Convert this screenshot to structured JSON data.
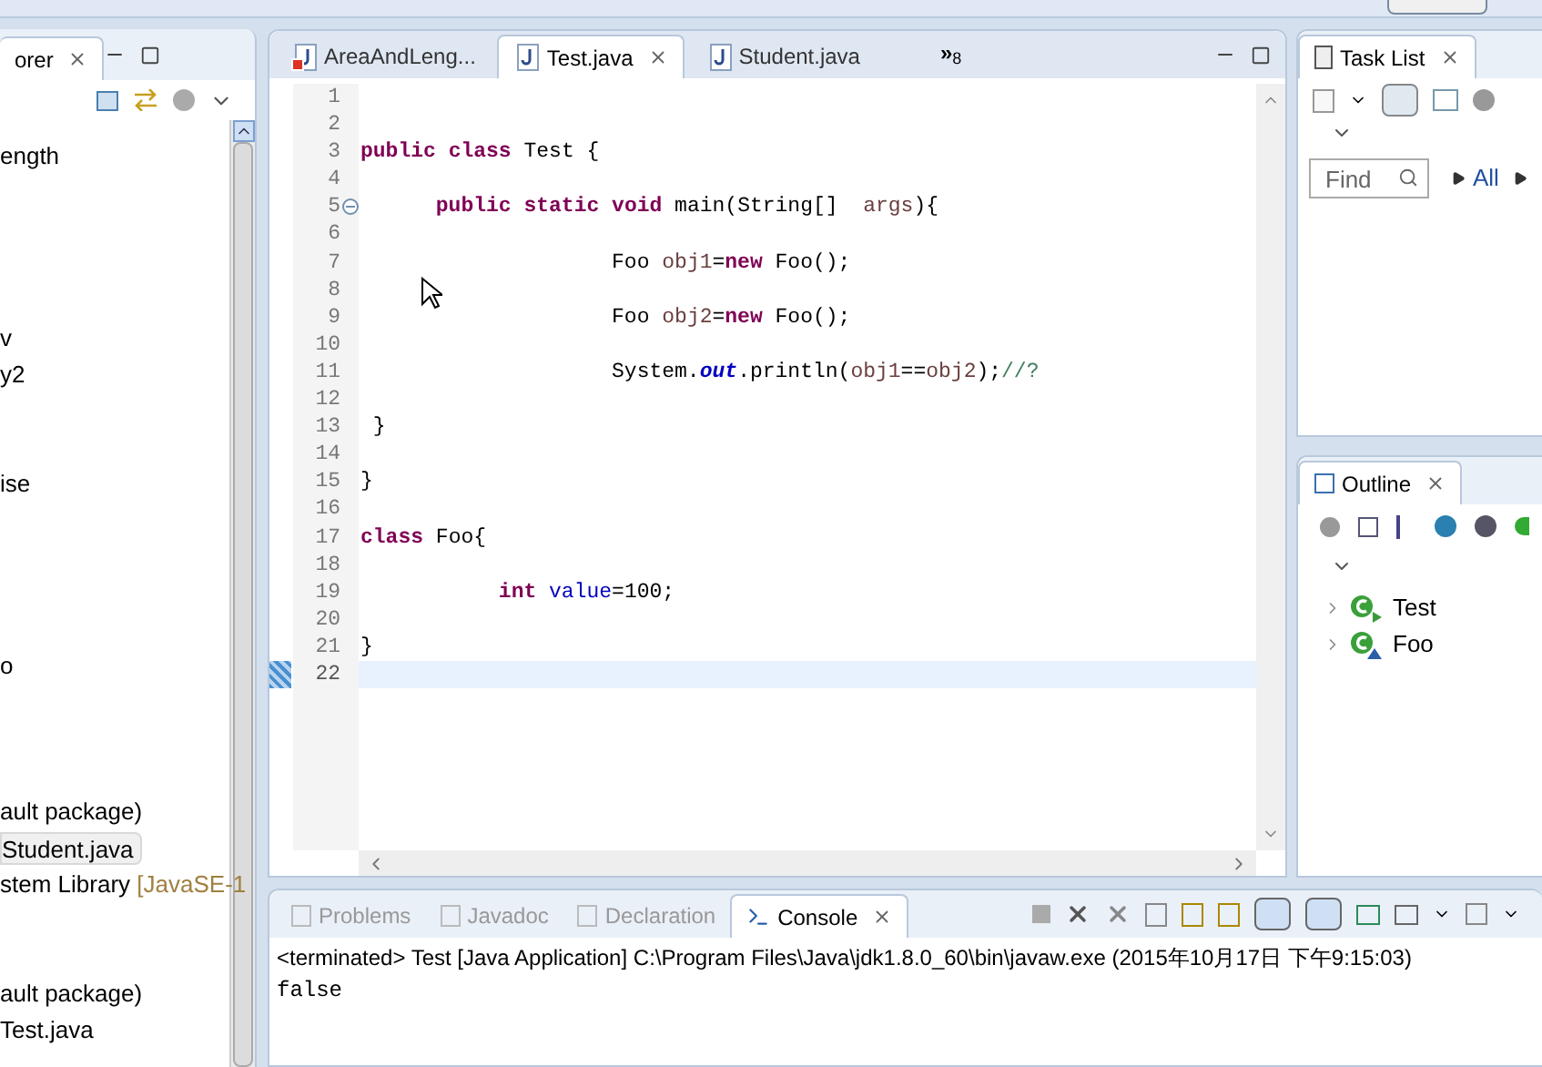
{
  "explorer": {
    "tab_title": "orer",
    "items": [
      {
        "text": "ength",
        "selected": false
      },
      {
        "text": "v",
        "selected": false
      },
      {
        "text": "y2",
        "selected": false
      },
      {
        "text": "ise",
        "selected": false
      },
      {
        "text": "o",
        "selected": false
      },
      {
        "text": "ault package)",
        "selected": false
      },
      {
        "text": "Student.java",
        "selected": true
      },
      {
        "text": "stem Library",
        "suffix": "[JavaSE-1",
        "selected": false
      },
      {
        "text": "ault package)",
        "selected": false
      },
      {
        "text": "Test.java",
        "selected": false
      }
    ]
  },
  "editor": {
    "tabs": [
      {
        "label": "AreaAndLeng...",
        "selected": false,
        "error": true
      },
      {
        "label": "Test.java",
        "selected": true,
        "error": false
      },
      {
        "label": "Student.java",
        "selected": false,
        "error": false
      }
    ],
    "overflow": {
      "glyph": "»",
      "count": "8"
    },
    "lines": [
      {
        "number": "1",
        "current": false,
        "foldable": false
      },
      {
        "number": "2",
        "current": false,
        "foldable": false
      },
      {
        "number": "3",
        "current": false,
        "foldable": false,
        "tokens": [
          {
            "text": "public",
            "kind": "keyword"
          },
          {
            "text": " class",
            "kind": "keyword"
          },
          {
            "text": " Test {",
            "kind": "plain"
          }
        ]
      },
      {
        "number": "4",
        "current": false,
        "foldable": false
      },
      {
        "number": "5",
        "current": false,
        "foldable": true,
        "tokens": [
          {
            "text": "      public",
            "kind": "keyword"
          },
          {
            "text": " static",
            "kind": "keyword"
          },
          {
            "text": " void",
            "kind": "keyword"
          },
          {
            "text": " main(String[]  ",
            "kind": "plain"
          },
          {
            "text": "args",
            "kind": "local"
          },
          {
            "text": "){",
            "kind": "plain"
          }
        ]
      },
      {
        "number": "6",
        "current": false,
        "foldable": false
      },
      {
        "number": "7",
        "current": false,
        "foldable": false,
        "tokens": [
          {
            "text": "                    Foo ",
            "kind": "plain"
          },
          {
            "text": "obj1",
            "kind": "local"
          },
          {
            "text": "=",
            "kind": "plain"
          },
          {
            "text": "new",
            "kind": "keyword"
          },
          {
            "text": " Foo();",
            "kind": "plain"
          }
        ]
      },
      {
        "number": "8",
        "current": false,
        "foldable": false
      },
      {
        "number": "9",
        "current": false,
        "foldable": false,
        "tokens": [
          {
            "text": "                    Foo ",
            "kind": "plain"
          },
          {
            "text": "obj2",
            "kind": "local"
          },
          {
            "text": "=",
            "kind": "plain"
          },
          {
            "text": "new",
            "kind": "keyword"
          },
          {
            "text": " Foo();",
            "kind": "plain"
          }
        ]
      },
      {
        "number": "10",
        "current": false,
        "foldable": false
      },
      {
        "number": "11",
        "current": false,
        "foldable": false,
        "tokens": [
          {
            "text": "                    System.",
            "kind": "plain"
          },
          {
            "text": "out",
            "kind": "static_field"
          },
          {
            "text": ".println(",
            "kind": "plain"
          },
          {
            "text": "obj1",
            "kind": "local"
          },
          {
            "text": "==",
            "kind": "plain"
          },
          {
            "text": "obj2",
            "kind": "local"
          },
          {
            "text": ");",
            "kind": "plain"
          },
          {
            "text": "//?",
            "kind": "comment"
          }
        ]
      },
      {
        "number": "12",
        "current": false,
        "foldable": false
      },
      {
        "number": "13",
        "current": false,
        "foldable": false,
        "tokens": [
          {
            "text": " }",
            "kind": "plain"
          }
        ]
      },
      {
        "number": "14",
        "current": false,
        "foldable": false
      },
      {
        "number": "15",
        "current": false,
        "foldable": false,
        "tokens": [
          {
            "text": "}",
            "kind": "plain"
          }
        ]
      },
      {
        "number": "16",
        "current": false,
        "foldable": false
      },
      {
        "number": "17",
        "current": false,
        "foldable": false,
        "tokens": [
          {
            "text": "class",
            "kind": "keyword"
          },
          {
            "text": " Foo{",
            "kind": "plain"
          }
        ]
      },
      {
        "number": "18",
        "current": false,
        "foldable": false
      },
      {
        "number": "19",
        "current": false,
        "foldable": false,
        "tokens": [
          {
            "text": "           int",
            "kind": "keyword"
          },
          {
            "text": " value",
            "kind": "field"
          },
          {
            "text": "=100;",
            "kind": "plain"
          }
        ]
      },
      {
        "number": "20",
        "current": false,
        "foldable": false
      },
      {
        "number": "21",
        "current": false,
        "foldable": false,
        "tokens": [
          {
            "text": "}",
            "kind": "plain"
          }
        ]
      },
      {
        "number": "22",
        "current": true,
        "foldable": false
      }
    ]
  },
  "task_list": {
    "tab_title": "Task List",
    "find": {
      "placeholder": "Find"
    },
    "filter_link": "All"
  },
  "outline": {
    "tab_title": "Outline",
    "items": [
      {
        "label": "Test",
        "expanded": false,
        "kind": "main_class"
      },
      {
        "label": "Foo",
        "kind": "class",
        "expanded": false
      }
    ]
  },
  "console": {
    "tabs": [
      {
        "label": "Problems",
        "selected": false
      },
      {
        "label": "Javadoc",
        "selected": false
      },
      {
        "label": "Declaration",
        "selected": false
      },
      {
        "label": "Console",
        "selected": true
      }
    ],
    "header": "<terminated> Test [Java Application] C:\\Program Files\\Java\\jdk1.8.0_60\\bin\\javaw.exe (2015年10月17日 下午9:15:03)",
    "output": "false"
  }
}
